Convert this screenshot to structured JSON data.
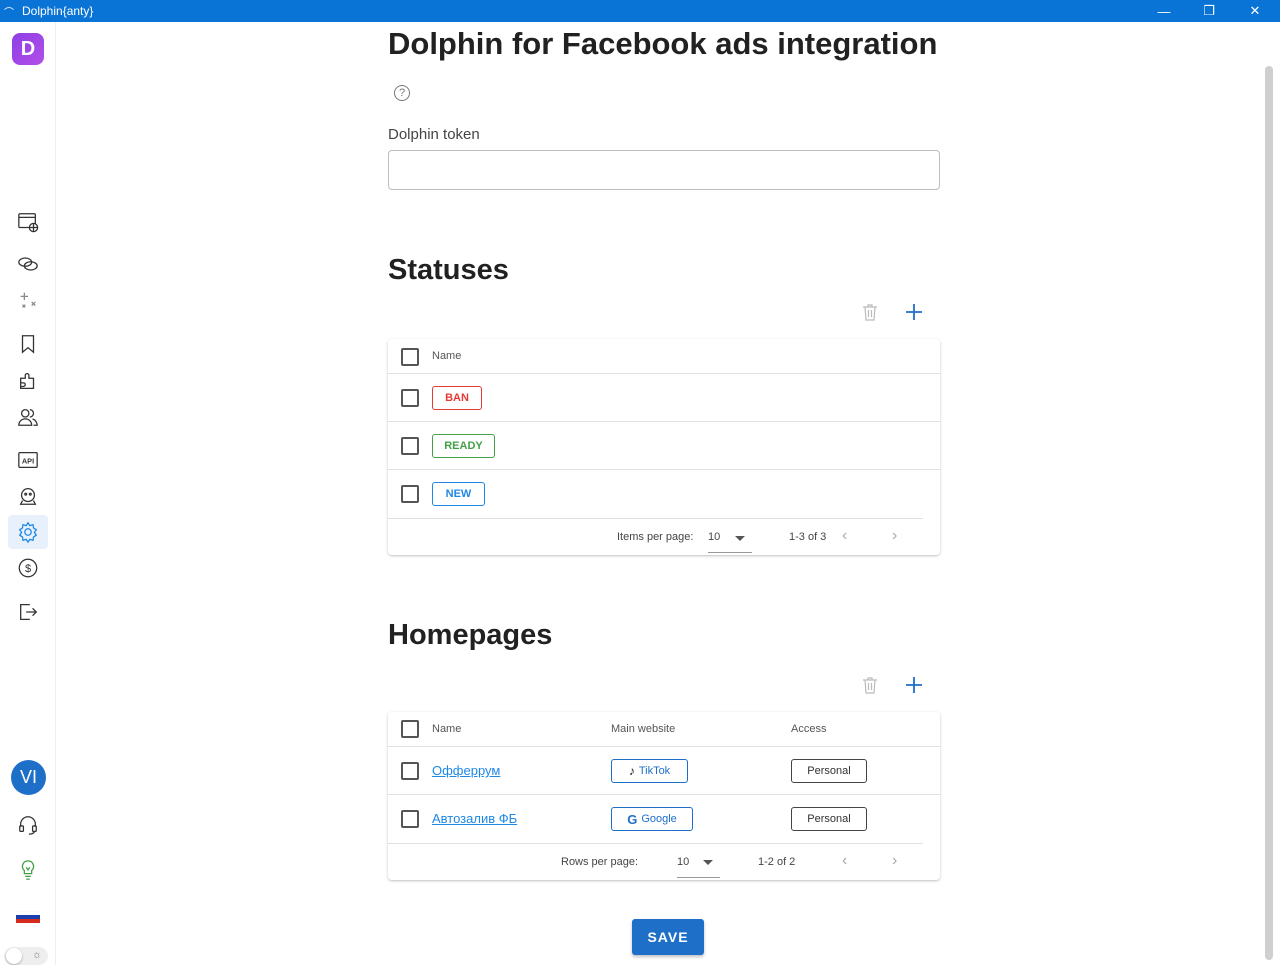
{
  "window": {
    "title": "Dolphin{anty}",
    "minimize": "—",
    "restore": "❐",
    "close": "✕"
  },
  "sidebar": {
    "logo_letter": "D",
    "user_initials": "VI",
    "theme_icon": "☼"
  },
  "page": {
    "title": "Dolphin for Facebook ads integration",
    "help": "?",
    "token_label": "Dolphin token",
    "token_value": ""
  },
  "statuses": {
    "heading": "Statuses",
    "column_name": "Name",
    "rows": [
      {
        "label": "BAN",
        "color": "#e53935"
      },
      {
        "label": "READY",
        "color": "#43a047"
      },
      {
        "label": "NEW",
        "color": "#1e88e5"
      }
    ],
    "items_per_page_label": "Items per page:",
    "items_per_page": "10",
    "range": "1-3 of 3"
  },
  "homepages": {
    "heading": "Homepages",
    "columns": {
      "name": "Name",
      "main_website": "Main website",
      "access": "Access"
    },
    "rows": [
      {
        "name": "Офферрум",
        "site": "TikTok",
        "access": "Personal"
      },
      {
        "name": "Автозалив ФБ",
        "site": "Google",
        "access": "Personal"
      }
    ],
    "rows_per_page_label": "Rows per page:",
    "rows_per_page": "10",
    "range": "1-2 of 2"
  },
  "save_label": "SAVE",
  "colors": {
    "accent": "#1e6fc8",
    "titlebar": "#0a74d6"
  }
}
